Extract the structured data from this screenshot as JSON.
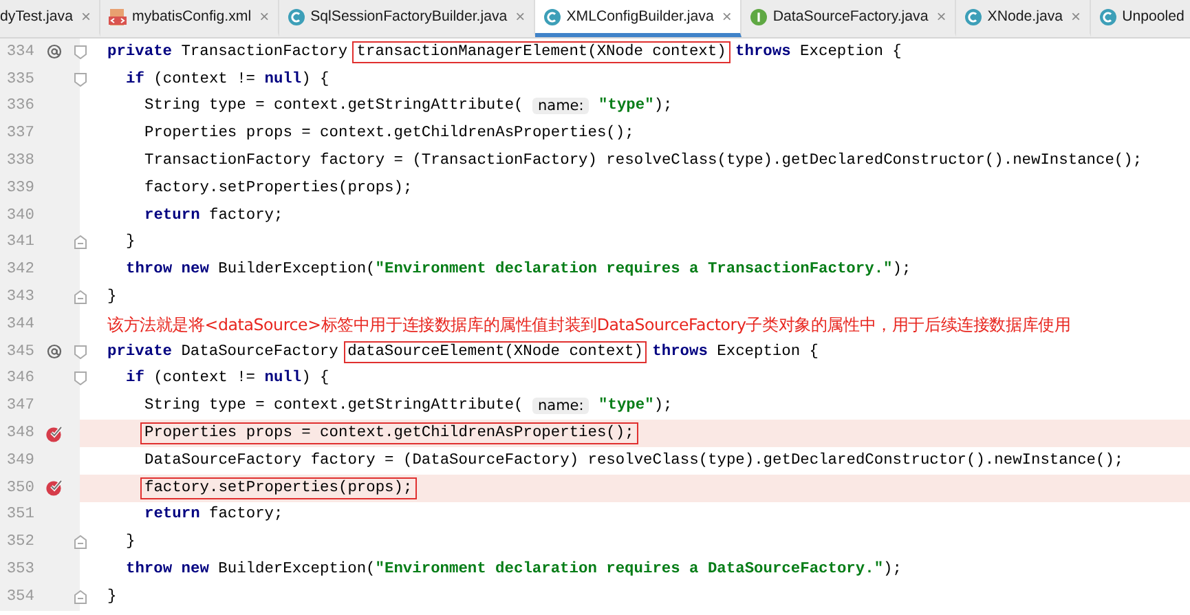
{
  "tabs": [
    {
      "label": "dyTest.java",
      "kind": "plain",
      "close": "×",
      "selected": false
    },
    {
      "label": "mybatisConfig.xml",
      "kind": "xml",
      "close": "×",
      "selected": false
    },
    {
      "label": "SqlSessionFactoryBuilder.java",
      "kind": "class",
      "close": "×",
      "selected": false
    },
    {
      "label": "XMLConfigBuilder.java",
      "kind": "class",
      "close": "×",
      "selected": true
    },
    {
      "label": "DataSourceFactory.java",
      "kind": "interface",
      "close": "×",
      "selected": false
    },
    {
      "label": "XNode.java",
      "kind": "class",
      "close": "×",
      "selected": false
    },
    {
      "label": "Unpooled",
      "kind": "class",
      "selected": false
    }
  ],
  "lines": [
    {
      "number": "334",
      "gutter_icons": [
        {
          "kind": "override"
        },
        {
          "kind": "fold_start"
        }
      ],
      "breakpoint": false,
      "segments": [
        {
          "kind": "code",
          "tokens": [
            {
              "kind": "keyword",
              "text": "private "
            },
            {
              "kind": "plain",
              "text": "TransactionFactory "
            }
          ]
        },
        {
          "kind": "boxed",
          "tokens": [
            {
              "kind": "plain",
              "text": "transactionManagerElement(XNode context)"
            }
          ]
        },
        {
          "kind": "code",
          "tokens": [
            {
              "kind": "keyword",
              "text": " throws "
            },
            {
              "kind": "plain",
              "text": "Exception {"
            }
          ]
        }
      ],
      "children": [
        {
          "number": "335",
          "gutter_icons": [
            {
              "kind": "fold_start"
            }
          ],
          "breakpoint": false,
          "segments": [
            {
              "kind": "code",
              "tokens": [
                {
                  "kind": "keyword",
                  "text": "if "
                },
                {
                  "kind": "plain",
                  "text": "(context != "
                },
                {
                  "kind": "keyword",
                  "text": "null"
                },
                {
                  "kind": "plain",
                  "text": ") {"
                }
              ]
            }
          ],
          "children": [
            {
              "number": "336",
              "breakpoint": false,
              "segments": [
                {
                  "kind": "code",
                  "tokens": [
                    {
                      "kind": "plain",
                      "text": "String type = context.getStringAttribute( "
                    }
                  ]
                },
                {
                  "kind": "hint",
                  "tokens": [
                    {
                      "kind": "plain",
                      "text": "name:"
                    }
                  ]
                },
                {
                  "kind": "code",
                  "tokens": [
                    {
                      "kind": "string",
                      "text": " \"type\""
                    },
                    {
                      "kind": "plain",
                      "text": ");"
                    }
                  ]
                }
              ]
            },
            {
              "number": "337",
              "breakpoint": false,
              "segments": [
                {
                  "kind": "code",
                  "tokens": [
                    {
                      "kind": "plain",
                      "text": "Properties props = context.getChildrenAsProperties();"
                    }
                  ]
                }
              ]
            },
            {
              "number": "338",
              "breakpoint": false,
              "segments": [
                {
                  "kind": "code",
                  "tokens": [
                    {
                      "kind": "plain",
                      "text": "TransactionFactory factory = (TransactionFactory) resolveClass(type).getDeclaredConstructor().newInstance();"
                    }
                  ]
                }
              ]
            },
            {
              "number": "339",
              "breakpoint": false,
              "segments": [
                {
                  "kind": "code",
                  "tokens": [
                    {
                      "kind": "plain",
                      "text": "factory.setProperties(props);"
                    }
                  ]
                }
              ]
            },
            {
              "number": "340",
              "breakpoint": false,
              "segments": [
                {
                  "kind": "code",
                  "tokens": [
                    {
                      "kind": "keyword",
                      "text": "return "
                    },
                    {
                      "kind": "plain",
                      "text": "factory;"
                    }
                  ]
                }
              ]
            }
          ]
        },
        {
          "number": "341",
          "gutter_icons": [
            {
              "kind": "fold_end"
            }
          ],
          "breakpoint": false,
          "segments": [
            {
              "kind": "code",
              "tokens": [
                {
                  "kind": "plain",
                  "text": "}"
                }
              ]
            }
          ]
        },
        {
          "number": "342",
          "breakpoint": false,
          "segments": [
            {
              "kind": "code",
              "tokens": [
                {
                  "kind": "keyword",
                  "text": "throw new "
                },
                {
                  "kind": "plain",
                  "text": "BuilderException("
                },
                {
                  "kind": "string",
                  "text": "\"Environment declaration requires a TransactionFactory.\""
                },
                {
                  "kind": "plain",
                  "text": ");"
                }
              ]
            }
          ]
        }
      ]
    },
    {
      "number": "343",
      "gutter_icons": [
        {
          "kind": "fold_end"
        }
      ],
      "breakpoint": false,
      "segments": [
        {
          "kind": "code",
          "tokens": [
            {
              "kind": "plain",
              "text": "}"
            }
          ]
        }
      ]
    },
    {
      "number": "344",
      "breakpoint": false,
      "segments": [
        {
          "kind": "note",
          "text": "该方法就是将<dataSource>标签中用于连接数据库的属性值封装到DataSourceFactory子类对象的属性中，用于后续连接数据库使用"
        }
      ]
    },
    {
      "number": "345",
      "gutter_icons": [
        {
          "kind": "override"
        },
        {
          "kind": "fold_start"
        }
      ],
      "breakpoint": false,
      "segments": [
        {
          "kind": "code",
          "tokens": [
            {
              "kind": "keyword",
              "text": "private "
            },
            {
              "kind": "plain",
              "text": "DataSourceFactory "
            }
          ]
        },
        {
          "kind": "boxed",
          "tokens": [
            {
              "kind": "plain",
              "text": "dataSourceElement(XNode context)"
            }
          ]
        },
        {
          "kind": "code",
          "tokens": [
            {
              "kind": "keyword",
              "text": " throws "
            },
            {
              "kind": "plain",
              "text": "Exception {"
            }
          ]
        }
      ],
      "children": [
        {
          "number": "346",
          "gutter_icons": [
            {
              "kind": "fold_start"
            }
          ],
          "breakpoint": false,
          "segments": [
            {
              "kind": "code",
              "tokens": [
                {
                  "kind": "keyword",
                  "text": "if "
                },
                {
                  "kind": "plain",
                  "text": "(context != "
                },
                {
                  "kind": "keyword",
                  "text": "null"
                },
                {
                  "kind": "plain",
                  "text": ") {"
                }
              ]
            }
          ],
          "children": [
            {
              "number": "347",
              "breakpoint": false,
              "segments": [
                {
                  "kind": "code",
                  "tokens": [
                    {
                      "kind": "plain",
                      "text": "String type = context.getStringAttribute( "
                    }
                  ]
                },
                {
                  "kind": "hint",
                  "tokens": [
                    {
                      "kind": "plain",
                      "text": "name:"
                    }
                  ]
                },
                {
                  "kind": "code",
                  "tokens": [
                    {
                      "kind": "string",
                      "text": " \"type\""
                    },
                    {
                      "kind": "plain",
                      "text": ");"
                    }
                  ]
                }
              ]
            },
            {
              "number": "348",
              "gutter_icons": [
                {
                  "kind": "breakpoint"
                }
              ],
              "breakpoint": true,
              "segments": [
                {
                  "kind": "boxed",
                  "tokens": [
                    {
                      "kind": "plain",
                      "text": "Properties props = context.getChildrenAsProperties();"
                    }
                  ]
                }
              ]
            },
            {
              "number": "349",
              "breakpoint": false,
              "segments": [
                {
                  "kind": "code",
                  "tokens": [
                    {
                      "kind": "plain",
                      "text": "DataSourceFactory factory = (DataSourceFactory) resolveClass(type).getDeclaredConstructor().newInstance();"
                    }
                  ]
                }
              ]
            },
            {
              "number": "350",
              "gutter_icons": [
                {
                  "kind": "breakpoint"
                }
              ],
              "breakpoint": true,
              "segments": [
                {
                  "kind": "boxed",
                  "tokens": [
                    {
                      "kind": "plain",
                      "text": "factory.setProperties(props);"
                    }
                  ]
                }
              ]
            },
            {
              "number": "351",
              "breakpoint": false,
              "segments": [
                {
                  "kind": "code",
                  "tokens": [
                    {
                      "kind": "keyword",
                      "text": "return "
                    },
                    {
                      "kind": "plain",
                      "text": "factory;"
                    }
                  ]
                }
              ]
            }
          ]
        },
        {
          "number": "352",
          "gutter_icons": [
            {
              "kind": "fold_end"
            }
          ],
          "breakpoint": false,
          "segments": [
            {
              "kind": "code",
              "tokens": [
                {
                  "kind": "plain",
                  "text": "}"
                }
              ]
            }
          ]
        },
        {
          "number": "353",
          "breakpoint": false,
          "segments": [
            {
              "kind": "code",
              "tokens": [
                {
                  "kind": "keyword",
                  "text": "throw new "
                },
                {
                  "kind": "plain",
                  "text": "BuilderException("
                },
                {
                  "kind": "string",
                  "text": "\"Environment declaration requires a DataSourceFactory.\""
                },
                {
                  "kind": "plain",
                  "text": ");"
                }
              ]
            }
          ]
        }
      ]
    },
    {
      "number": "354",
      "gutter_icons": [
        {
          "kind": "fold_end"
        }
      ],
      "breakpoint": false,
      "segments": [
        {
          "kind": "code",
          "tokens": [
            {
              "kind": "plain",
              "text": "}"
            }
          ]
        }
      ]
    }
  ]
}
